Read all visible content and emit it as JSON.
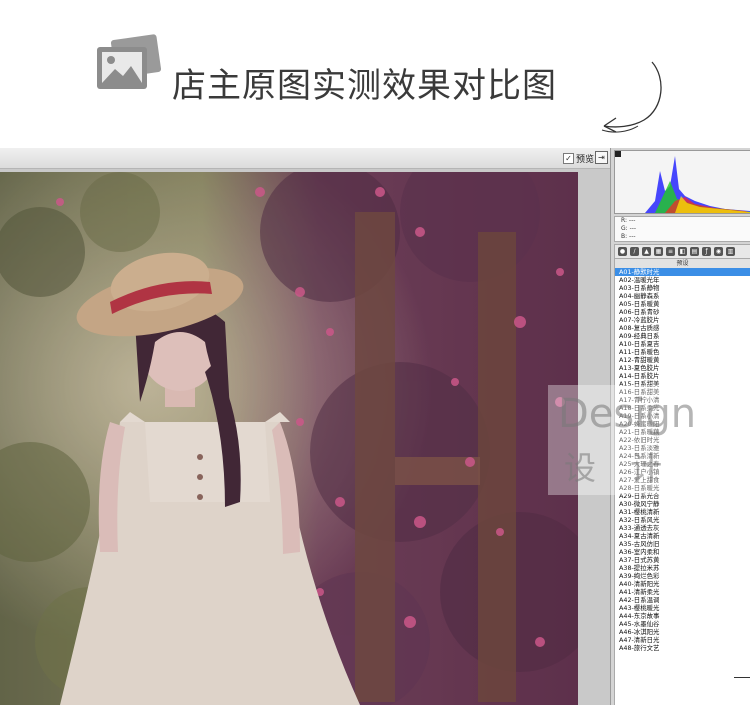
{
  "banner": {
    "title": "店主原图实测效果对比图",
    "icon": "photo-icon"
  },
  "editor": {
    "preview_label": "预览",
    "preview_checked": true,
    "export_icon": "export-icon"
  },
  "panel": {
    "rgb": {
      "r": "R: ---",
      "g": "G: ---",
      "b": "B: ---"
    },
    "preset_header": "预设",
    "presets": [
      "A01-静默时光",
      "A02-温暖光年",
      "A03-日系静物",
      "A04-幽静森系",
      "A05-日系暖黄",
      "A06-日系青砂",
      "A07-冷蓝胶片",
      "A08-复古质感",
      "A09-经典日系",
      "A10-日系夏吉",
      "A11-日系暖色",
      "A12-青甜暖黄",
      "A13-夏色胶片",
      "A14-日系胶片",
      "A15-日系甜美",
      "A16-日系甜美",
      "A17-青柠小清",
      "A18-日系柔光",
      "A19-日系小清",
      "A20-蜂蜜暖阳",
      "A21-日系暖藕",
      "A22-依旧时光",
      "A23-日系淡雅",
      "A24-日系清新",
      "A25-大理之春",
      "A26-江户小镇",
      "A27-爱上甜食",
      "A28-日系暖光",
      "A29-日系光合",
      "A30-微风宁静",
      "A31-樱桃清新",
      "A32-日系风光",
      "A33-通透去灰",
      "A34-夏古清新",
      "A35-古风仿旧",
      "A36-室内柔和",
      "A37-日式苏黄",
      "A38-提拉米苏",
      "A39-绚烂色彩",
      "A40-清新阳光",
      "A41-清新柔光",
      "A42-日系温调",
      "A43-樱桃暖光",
      "A44-东京故事",
      "A45-水墨仙谷",
      "A46-冰淇阳光",
      "A47-清新日光",
      "A48-旅行文艺"
    ]
  },
  "watermark": {
    "line1": "Design",
    "line2": "设 计"
  },
  "colors": {
    "selection": "#3b8ee6",
    "photo_tone": "#6f3f58"
  }
}
